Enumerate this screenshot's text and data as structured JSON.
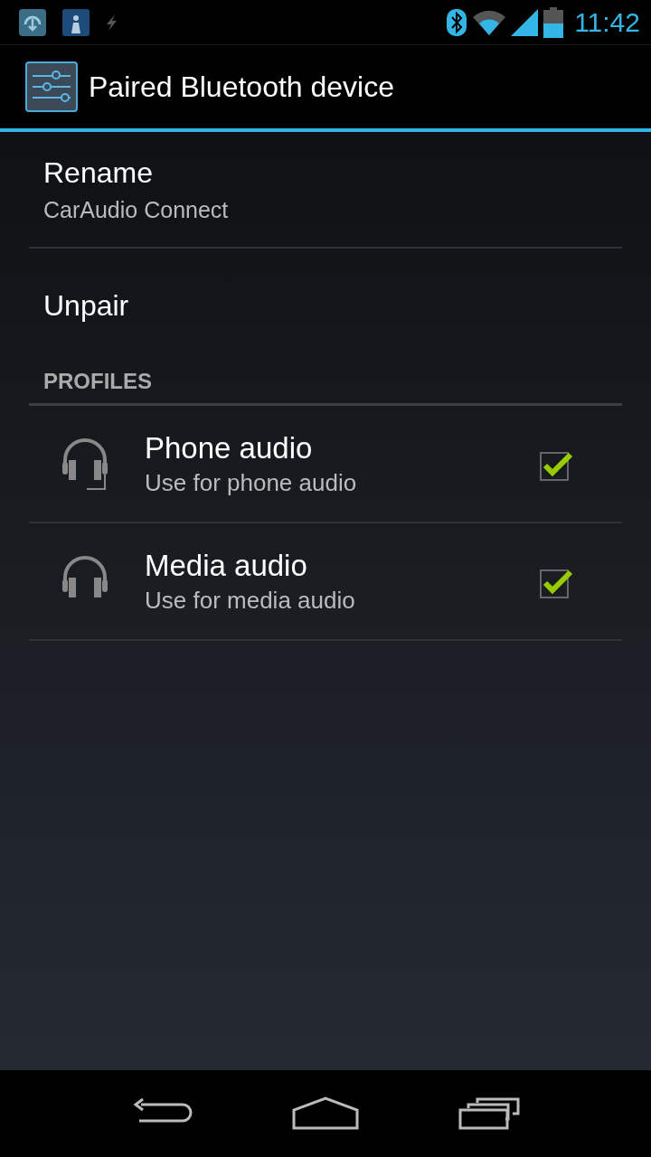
{
  "status_bar": {
    "time": "11:42"
  },
  "action_bar": {
    "title": "Paired Bluetooth device"
  },
  "items": [
    {
      "title": "Rename",
      "summary": "CarAudio Connect"
    },
    {
      "title": "Unpair"
    }
  ],
  "profiles_header": "PROFILES",
  "profiles": [
    {
      "kind": "headset",
      "title": "Phone audio",
      "summary": "Use for phone audio",
      "checked": true
    },
    {
      "kind": "headphones",
      "title": "Media audio",
      "summary": "Use for media audio",
      "checked": true
    }
  ]
}
